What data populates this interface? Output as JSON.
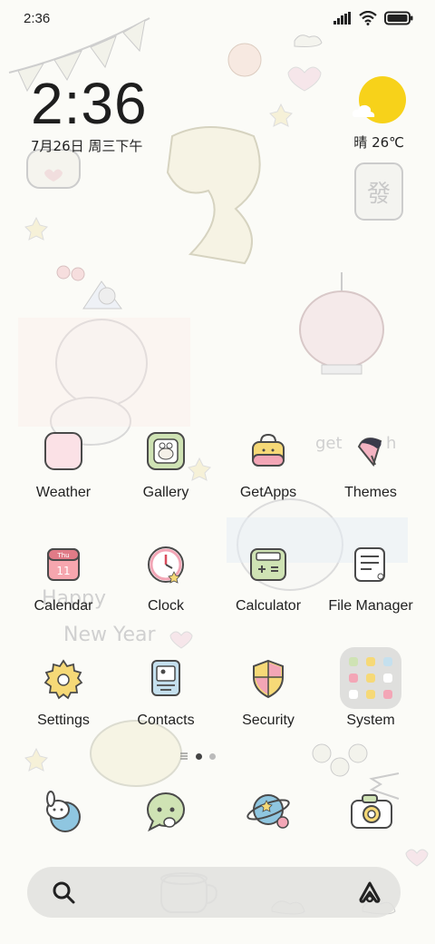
{
  "status_bar": {
    "time": "2:36"
  },
  "clock_widget": {
    "time": "2:36",
    "date": "7月26日 周三下午"
  },
  "weather_widget": {
    "text": "晴 26℃"
  },
  "apps": {
    "weather": "Weather",
    "gallery": "Gallery",
    "getapps": "GetApps",
    "themes": "Themes",
    "calendar": "Calendar",
    "clock": "Clock",
    "calculator": "Calculator",
    "file_manager": "File Manager",
    "settings": "Settings",
    "contacts": "Contacts",
    "security": "Security",
    "system": "System"
  },
  "calendar_icon": {
    "day_name": "Thu",
    "day_number": "11"
  },
  "wallpaper_text": {
    "line1": "Happy",
    "line2": "New Year",
    "line3": "get",
    "line4": "h"
  },
  "colors": {
    "sun": "#f7d21a",
    "accent": "#7ec3d8"
  }
}
